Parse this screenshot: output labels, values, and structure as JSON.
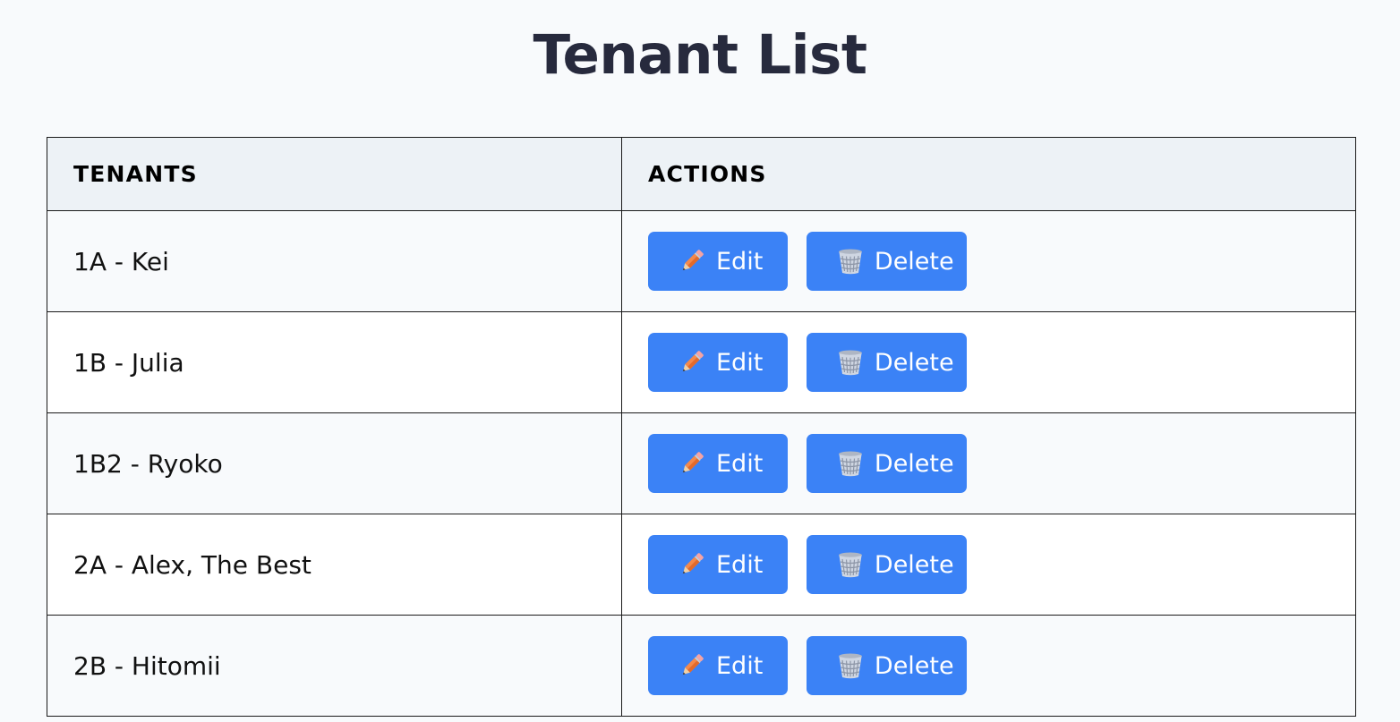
{
  "page": {
    "title": "Tenant List"
  },
  "table": {
    "headers": {
      "tenants": "Tenants",
      "actions": "Actions"
    },
    "rows": [
      {
        "tenant": "1A - Kei"
      },
      {
        "tenant": "1B - Julia"
      },
      {
        "tenant": "1B2 - Ryoko"
      },
      {
        "tenant": "2A - Alex, The Best"
      },
      {
        "tenant": "2B - Hitomii"
      }
    ]
  },
  "actions": {
    "edit_label": "Edit",
    "delete_label": "Delete",
    "edit_icon": "pencil-icon",
    "delete_icon": "wastebasket-icon"
  },
  "colors": {
    "button": "#3b82f6",
    "title": "#272a3d",
    "header_bg": "#edf2f6",
    "page_bg": "#f8fafc"
  }
}
